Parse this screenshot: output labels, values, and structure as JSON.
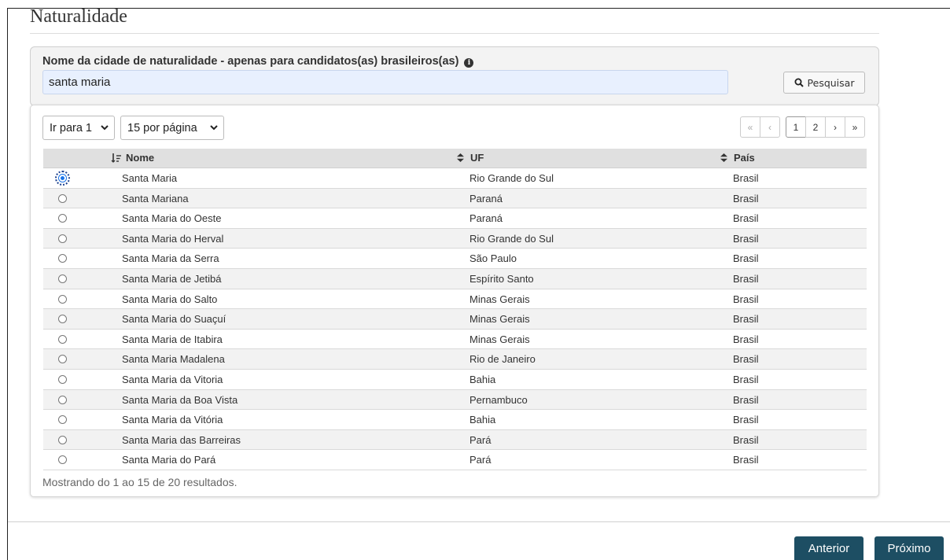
{
  "section": {
    "title": "Naturalidade"
  },
  "search": {
    "label": "Nome da cidade de naturalidade - apenas para candidatos(as) brasileiros(as)",
    "value": "santa maria",
    "button_label": "Pesquisar"
  },
  "controls": {
    "goto_page": "Ir para 1",
    "per_page": "15 por página"
  },
  "pagination": {
    "first": "«",
    "prev": "‹",
    "pages": [
      "1",
      "2"
    ],
    "current": "1",
    "next": "›",
    "last": "»"
  },
  "table": {
    "columns": [
      "Nome",
      "UF",
      "País"
    ],
    "rows": [
      {
        "nome": "Santa Maria",
        "uf": "Rio Grande do Sul",
        "pais": "Brasil",
        "selected": true
      },
      {
        "nome": "Santa Mariana",
        "uf": "Paraná",
        "pais": "Brasil",
        "selected": false
      },
      {
        "nome": "Santa Maria do Oeste",
        "uf": "Paraná",
        "pais": "Brasil",
        "selected": false
      },
      {
        "nome": "Santa Maria do Herval",
        "uf": "Rio Grande do Sul",
        "pais": "Brasil",
        "selected": false
      },
      {
        "nome": "Santa Maria da Serra",
        "uf": "São Paulo",
        "pais": "Brasil",
        "selected": false
      },
      {
        "nome": "Santa Maria de Jetibá",
        "uf": "Espírito Santo",
        "pais": "Brasil",
        "selected": false
      },
      {
        "nome": "Santa Maria do Salto",
        "uf": "Minas Gerais",
        "pais": "Brasil",
        "selected": false
      },
      {
        "nome": "Santa Maria do Suaçuí",
        "uf": "Minas Gerais",
        "pais": "Brasil",
        "selected": false
      },
      {
        "nome": "Santa Maria de Itabira",
        "uf": "Minas Gerais",
        "pais": "Brasil",
        "selected": false
      },
      {
        "nome": "Santa Maria Madalena",
        "uf": "Rio de Janeiro",
        "pais": "Brasil",
        "selected": false
      },
      {
        "nome": "Santa Maria da Vitoria",
        "uf": "Bahia",
        "pais": "Brasil",
        "selected": false
      },
      {
        "nome": "Santa Maria da Boa Vista",
        "uf": "Pernambuco",
        "pais": "Brasil",
        "selected": false
      },
      {
        "nome": "Santa Maria da Vitória",
        "uf": "Bahia",
        "pais": "Brasil",
        "selected": false
      },
      {
        "nome": "Santa Maria das Barreiras",
        "uf": "Pará",
        "pais": "Brasil",
        "selected": false
      },
      {
        "nome": "Santa Maria do Pará",
        "uf": "Pará",
        "pais": "Brasil",
        "selected": false
      }
    ],
    "footer": "Mostrando do 1 ao 15 de 20 resultados."
  },
  "navigation": {
    "previous_label": "Anterior",
    "next_label": "Próximo"
  },
  "colors": {
    "nav_button_bg": "#1d4e63",
    "input_bg": "#e8f0fe",
    "header_bg": "#e0e0e0",
    "selected_radio": "#1a73e8"
  },
  "icons": {
    "info": "info-icon",
    "search": "search-icon",
    "sort_alpha": "sort-alpha-icon",
    "sort_both": "sort-icon",
    "dropdown": "chevron-down-icon"
  }
}
